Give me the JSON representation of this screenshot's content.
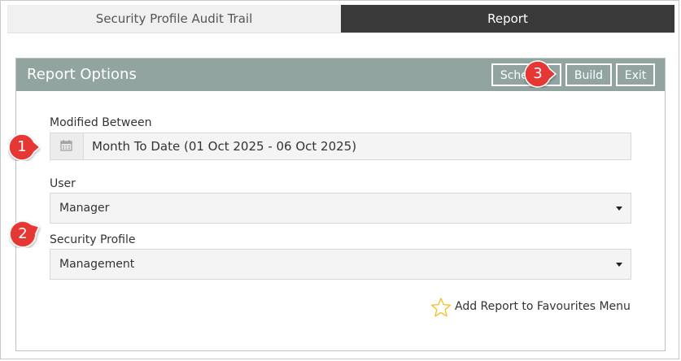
{
  "tabs": {
    "audit_trail": "Security Profile Audit Trail",
    "report": "Report"
  },
  "panel": {
    "title": "Report Options",
    "buttons": {
      "schedule": "Schedule",
      "build": "Build",
      "exit": "Exit"
    }
  },
  "form": {
    "modified_between": {
      "label": "Modified Between",
      "icon": "calendar-icon",
      "value": "Month To Date (01 Oct 2025 - 06 Oct 2025)"
    },
    "user": {
      "label": "User",
      "value": "Manager"
    },
    "security_profile": {
      "label": "Security Profile",
      "value": "Management"
    }
  },
  "favourites": {
    "icon": "star-icon",
    "label": "Add Report to Favourites Menu"
  },
  "callouts": [
    "1",
    "2",
    "3"
  ],
  "colors": {
    "header_bg": "#92a49f",
    "tab_active_bg": "#3a3a3a",
    "callout_red": "#e53935",
    "star_yellow": "#f1c232"
  }
}
